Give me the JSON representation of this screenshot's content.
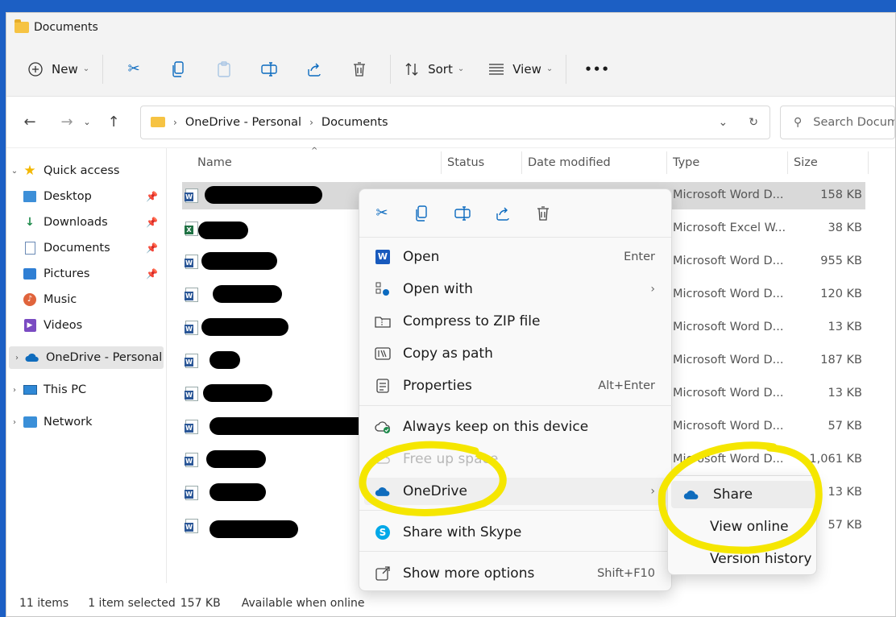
{
  "window": {
    "title": "Documents"
  },
  "toolbar": {
    "new_label": "New",
    "sort_label": "Sort",
    "view_label": "View",
    "more_label": "•••"
  },
  "address": {
    "crumbs": [
      "OneDrive - Personal",
      "Documents"
    ],
    "search_placeholder": "Search Documents"
  },
  "sidebar": {
    "quick_access": "Quick access",
    "items": [
      {
        "label": "Desktop",
        "icon": "desktop-icon",
        "pinned": true
      },
      {
        "label": "Downloads",
        "icon": "download-icon",
        "pinned": true
      },
      {
        "label": "Documents",
        "icon": "document-icon",
        "pinned": true
      },
      {
        "label": "Pictures",
        "icon": "picture-icon",
        "pinned": true
      },
      {
        "label": "Music",
        "icon": "music-icon",
        "pinned": false
      },
      {
        "label": "Videos",
        "icon": "video-icon",
        "pinned": false
      }
    ],
    "onedrive": "OneDrive - Personal",
    "thispc": "This PC",
    "network": "Network"
  },
  "columns": {
    "name": "Name",
    "status": "Status",
    "date": "Date modified",
    "type": "Type",
    "size": "Size"
  },
  "files": [
    {
      "type": "Microsoft Word D...",
      "size": "158 KB",
      "kind": "word"
    },
    {
      "type": "Microsoft Excel W...",
      "size": "38 KB",
      "kind": "excel"
    },
    {
      "type": "Microsoft Word D...",
      "size": "955 KB",
      "kind": "word"
    },
    {
      "type": "Microsoft Word D...",
      "size": "120 KB",
      "kind": "word"
    },
    {
      "type": "Microsoft Word D...",
      "size": "13 KB",
      "kind": "word"
    },
    {
      "type": "Microsoft Word D...",
      "size": "187 KB",
      "kind": "word"
    },
    {
      "type": "Microsoft Word D...",
      "size": "13 KB",
      "kind": "word"
    },
    {
      "type": "Microsoft Word D...",
      "size": "57 KB",
      "kind": "word"
    },
    {
      "type": "Microsoft Word D...",
      "size": "1,061 KB",
      "kind": "word"
    },
    {
      "type": "Microsoft Word D...",
      "size": "13 KB",
      "kind": "word"
    },
    {
      "type": "Microsoft Word D...",
      "size": "57 KB",
      "kind": "word"
    }
  ],
  "status": {
    "items": "11 items",
    "selected": "1 item selected",
    "size": "157 KB",
    "availability": "Available when online"
  },
  "context_menu": {
    "open": "Open",
    "open_shortcut": "Enter",
    "open_with": "Open with",
    "compress": "Compress to ZIP file",
    "copy_path": "Copy as path",
    "properties": "Properties",
    "properties_shortcut": "Alt+Enter",
    "keep": "Always keep on this device",
    "free_up": "Free up space",
    "onedrive": "OneDrive",
    "skype": "Share with Skype",
    "more": "Show more options",
    "more_shortcut": "Shift+F10"
  },
  "submenu": {
    "share": "Share",
    "view_online": "View online",
    "version_history": "Version history"
  },
  "colors": {
    "highlight": "#f5e600",
    "accent": "#0b6abf",
    "desktop_bg": "#1c5fc4"
  }
}
